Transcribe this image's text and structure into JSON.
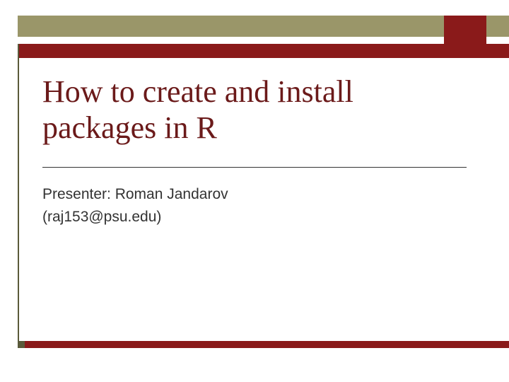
{
  "title": "How to create and install packages in R",
  "presenter_line1": "Presenter: Roman Jandarov",
  "presenter_line2": "(raj153@psu.edu)"
}
